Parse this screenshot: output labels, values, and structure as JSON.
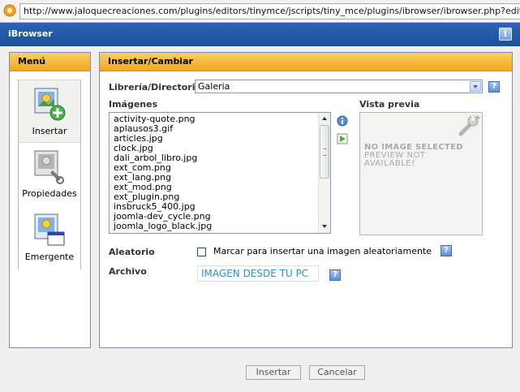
{
  "browser": {
    "url": "http://www.jaloquecreaciones.com/plugins/editors/tinymce/jscripts/tiny_mce/plugins/ibrowser/ibrowser.php?editor=[object"
  },
  "dialog": {
    "title": "iBrowser",
    "info_icon": "i"
  },
  "menu": {
    "heading": "Menú",
    "items": [
      {
        "label": "Insertar",
        "icon": "insert-image-icon",
        "active": true
      },
      {
        "label": "Propiedades",
        "icon": "properties-image-icon",
        "active": false
      },
      {
        "label": "Emergente",
        "icon": "popup-image-icon",
        "active": false
      }
    ]
  },
  "main": {
    "heading": "Insertar/Cambiar",
    "library_label": "Librería/Directorio",
    "library_value": "Galeria",
    "images_label": "Imágenes",
    "images": [
      "activity-quote.png",
      "aplausos3.gif",
      "articles.jpg",
      "clock.jpg",
      "dali_arbol_libro.jpg",
      "ext_com.png",
      "ext_lang.png",
      "ext_mod.png",
      "ext_plugin.png",
      "insbruck5_400.jpg",
      "joomla-dev_cycle.png",
      "joomla_logo_black.jpg"
    ],
    "preview_label": "Vista previa",
    "preview_message": {
      "line1": "NO IMAGE SELECTED",
      "line2": "PREVIEW NOT",
      "line3": "AVAILABLE!"
    },
    "random_label": "Aleatorio",
    "random_text": "Marcar para insertar una imagen aleatoriamente",
    "random_checked": false,
    "file_label": "Archivo",
    "file_link": "IMAGEN DESDE TU PC",
    "help_icon": "?"
  },
  "footer": {
    "insert_label": "Insertar",
    "cancel_label": "Cancelar"
  },
  "colors": {
    "title_bar": "#1b4f9a",
    "panel_header": "#f2a81c",
    "link": "#2f8fd0"
  }
}
